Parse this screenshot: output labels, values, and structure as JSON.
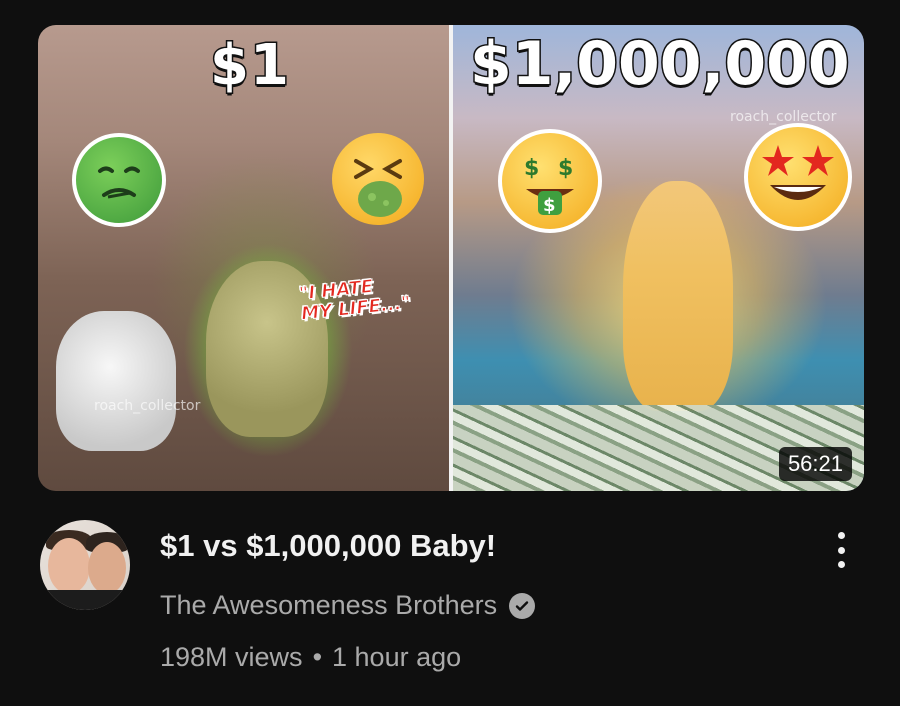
{
  "video": {
    "thumbnail": {
      "left_price": "$1",
      "right_price": "$1,000,000",
      "caption": "\"I HATE\nMY LIFE...\"",
      "watermark_left": "roach_collector",
      "watermark_right": "roach_collector",
      "duration": "56:21",
      "emojis": {
        "left_1": "nauseated-face",
        "left_2": "vomiting-face",
        "right_1": "money-mouth-face",
        "right_2": "star-struck-face"
      }
    },
    "title": "$1 vs $1,000,000 Baby!",
    "channel": "The Awesomeness Brothers",
    "verified": true,
    "views": "198M views",
    "separator": "•",
    "age": "1 hour ago"
  },
  "colors": {
    "background": "#0f0f0f",
    "primary_text": "#f1f1f1",
    "secondary_text": "#aaaaaa",
    "caption_red": "#e3281f"
  }
}
